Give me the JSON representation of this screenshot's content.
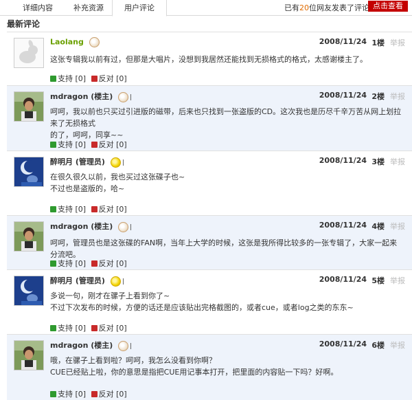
{
  "tabs": [
    {
      "label": "详细内容"
    },
    {
      "label": "补充资源"
    },
    {
      "label": "用户评论"
    }
  ],
  "summary": {
    "prefix": "已有",
    "count": "20",
    "suffix": "位网友发表了评论"
  },
  "view_button": "点击查看",
  "section_title": "最新评论",
  "vote": {
    "support": "支持",
    "oppose": "反对"
  },
  "comments": [
    {
      "user": "Laolang",
      "date": "2008/11/24",
      "floor": "1楼",
      "report": "举报",
      "lines": [
        "这张专辑我以前有过，但那是大唱片，没想到我居然还能找到无损格式的格式，太感谢楼主了。"
      ],
      "support_count": "[0]",
      "oppose_count": "[0]"
    },
    {
      "user": "mdragon (楼主)",
      "date": "2008/11/24",
      "floor": "2楼",
      "report": "举报",
      "lines": [
        "呵呵，我以前也只买过引进版的磁带，后来也只找到一张盗版的CD。这次我也是历尽千辛万苦从网上划拉来了无损格式",
        "的了，呵呵，同享~~"
      ],
      "support_count": "[0]",
      "oppose_count": "[0]"
    },
    {
      "user": "醉明月 (管理员)",
      "date": "2008/11/24",
      "floor": "3楼",
      "report": "举报",
      "lines": [
        "在很久很久以前，我也买过这张碟子也~",
        "不过也是盗版的，哈~"
      ],
      "support_count": "[0]",
      "oppose_count": "[0]"
    },
    {
      "user": "mdragon (楼主)",
      "date": "2008/11/24",
      "floor": "4楼",
      "report": "举报",
      "lines": [
        "呵呵，管理员也是这张碟的FAN啊，当年上大学的时候，这张是我所得比较多的一张专辑了，大家一起来分流吧。"
      ],
      "support_count": "[0]",
      "oppose_count": "[0]"
    },
    {
      "user": "醉明月 (管理员)",
      "date": "2008/11/24",
      "floor": "5楼",
      "report": "举报",
      "lines": [
        "多说一句，刚才在骡子上看到你了~",
        "不过下次发布的时候，方便的话还是应该贴出完格截图的，或者cue，或者log之类的东东~"
      ],
      "support_count": "[0]",
      "oppose_count": "[0]"
    },
    {
      "user": "mdragon (楼主)",
      "date": "2008/11/24",
      "floor": "6楼",
      "report": "举报",
      "lines": [
        "哦，在骡子上看到啦？呵呵，我怎么没看到你啊？",
        "CUE已经贴上啦，你的意思是指把CUE用记事本打开，把里面的内容贴一下吗？好啊。"
      ],
      "support_count": "[0]",
      "oppose_count": "[0]"
    }
  ]
}
